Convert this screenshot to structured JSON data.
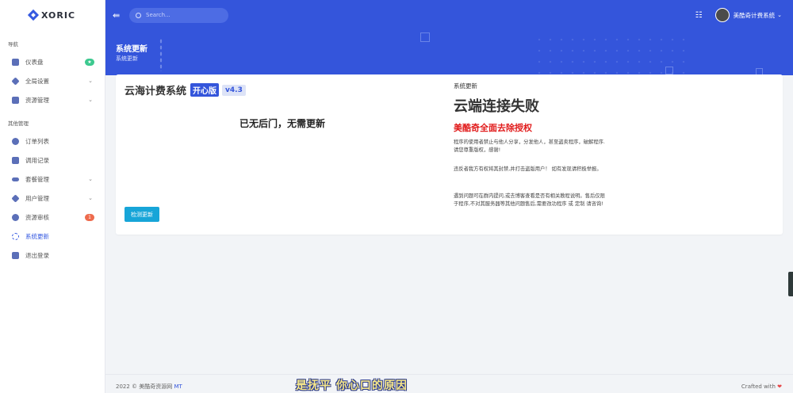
{
  "brand": {
    "name": "XORIC"
  },
  "sidebar": {
    "section_nav": "导航",
    "section_other": "其他管理",
    "items": [
      {
        "label": "仪表盘",
        "badge": "★"
      },
      {
        "label": "全局设置",
        "chevron": "⌄"
      },
      {
        "label": "资源管理",
        "chevron": "⌄"
      },
      {
        "label": "订单列表"
      },
      {
        "label": "调用记录"
      },
      {
        "label": "套餐管理",
        "chevron": "⌄"
      },
      {
        "label": "用户管理",
        "chevron": "⌄"
      },
      {
        "label": "资源审核",
        "badge": "1"
      },
      {
        "label": "系统更新"
      },
      {
        "label": "退出登录"
      }
    ]
  },
  "topbar": {
    "search_placeholder": "Search...",
    "user_name": "美酷奇计费系统",
    "user_chevron": "⌄",
    "menu_icon": "⇚",
    "settings_icon": "☷"
  },
  "banner": {
    "title": "系统更新",
    "breadcrumb": "系统更新"
  },
  "left_panel": {
    "app_name": "云海计费系统",
    "edition": "开心版",
    "version": "v4.3",
    "message": "已无后门，无需更新",
    "check_button": "检测更新"
  },
  "right_panel": {
    "label": "系统更新",
    "heading": "云端连接失败",
    "subheading": "美酷奇全面去除授权",
    "para1": "程序的使用者禁止与他人分享，分发他人，甚至盗卖程序，破解程序. 请您尊重版权，感谢!",
    "para2": "违反者我方有权将其封禁,并打击盗版用户！ 如有发现请积极举报。",
    "para3": "遇到问题可在群内提问,或去博客查看是否有相关教程说明。售后仅限于程序,不对其服务器等其他问题售后,需要改功程序 或 定制 请咨询!"
  },
  "footer": {
    "copyright_prefix": "2022 © 美酷奇资源网",
    "copyright_link": "MT",
    "crafted": "Crafted with",
    "heart": "❤"
  },
  "overlay_caption": "是抚平 你心口的原因"
}
